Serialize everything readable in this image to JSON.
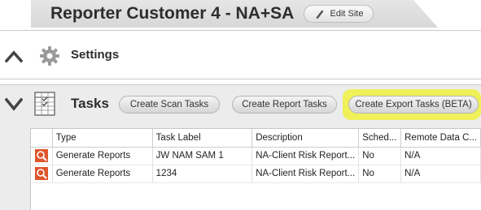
{
  "header": {
    "site_title": "Reporter Customer 4 - NA+SA",
    "edit_site_label": "Edit Site"
  },
  "settings": {
    "label": "Settings"
  },
  "tasks": {
    "label": "Tasks",
    "buttons": {
      "create_scan": "Create Scan Tasks",
      "create_report": "Create Report Tasks",
      "create_export": "Create Export Tasks (BETA)"
    },
    "table": {
      "columns": [
        "Type",
        "Task Label",
        "Description",
        "Sched...",
        "Remote Data C..."
      ],
      "rows": [
        {
          "type": "Generate Reports",
          "task_label": "JW NAM SAM 1",
          "description": "NA-Client Risk Report...",
          "sched": "No",
          "remote": "N/A"
        },
        {
          "type": "Generate Reports",
          "task_label": "1234",
          "description": "NA-Client Risk Report...",
          "sched": "No",
          "remote": "N/A"
        }
      ]
    }
  },
  "colors": {
    "highlight": "#f1f14a",
    "row_icon": "#e0552c"
  },
  "icons": {
    "collapse": "chevron-up-icon",
    "expand": "chevron-down-icon",
    "settings": "gear-icon",
    "tasks": "spreadsheet-icon",
    "edit": "pencil-icon",
    "row": "report-icon"
  }
}
